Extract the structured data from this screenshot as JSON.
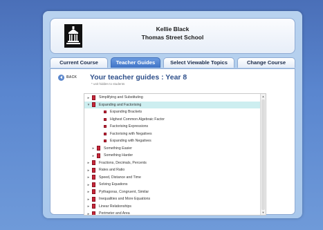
{
  "header": {
    "teacher_name": "Kellie Black",
    "school_name": "Thomas Street School",
    "logo_icon": "school-building-icon"
  },
  "tabs": [
    {
      "label": "Current Course",
      "active": false
    },
    {
      "label": "Teacher Guides",
      "active": true
    },
    {
      "label": "Select Viewable Topics",
      "active": false
    },
    {
      "label": "Change Course",
      "active": false
    }
  ],
  "content": {
    "back_label": "BACK",
    "title": "Your teacher guides : Year 8",
    "subtitle": "* unit hidden to students"
  },
  "tree": {
    "rows": [
      {
        "label": "Simplifying and Substituting",
        "level": 0,
        "arrow": "►",
        "highlight": false,
        "small": false
      },
      {
        "label": "Expanding and Factorising",
        "level": 0,
        "arrow": "▼",
        "highlight": true,
        "small": false
      },
      {
        "label": "Expanding Brackets",
        "level": 1,
        "arrow": "",
        "highlight": false,
        "small": true
      },
      {
        "label": "Highest Common Algebraic Factor",
        "level": 1,
        "arrow": "",
        "highlight": false,
        "small": true
      },
      {
        "label": "Factorising Expressions",
        "level": 1,
        "arrow": "",
        "highlight": false,
        "small": true
      },
      {
        "label": "Factorising with Negatives",
        "level": 1,
        "arrow": "",
        "highlight": false,
        "small": true
      },
      {
        "label": "Expanding with Negatives",
        "level": 1,
        "arrow": "",
        "highlight": false,
        "small": true
      },
      {
        "label": "Something Easier",
        "level": 2,
        "arrow": "►",
        "highlight": false,
        "small": false
      },
      {
        "label": "Something Harder",
        "level": 2,
        "arrow": "►",
        "highlight": false,
        "small": false
      },
      {
        "label": "Fractions, Decimals, Percents",
        "level": 0,
        "arrow": "►",
        "highlight": false,
        "small": false
      },
      {
        "label": "Rates and Ratio",
        "level": 0,
        "arrow": "►",
        "highlight": false,
        "small": false
      },
      {
        "label": "Speed, Distance and Time",
        "level": 0,
        "arrow": "►",
        "highlight": false,
        "small": false
      },
      {
        "label": "Solving Equations",
        "level": 0,
        "arrow": "►",
        "highlight": false,
        "small": false
      },
      {
        "label": "Pythagoras, Congruent, Similar",
        "level": 0,
        "arrow": "►",
        "highlight": false,
        "small": false
      },
      {
        "label": "Inequalities and More Equations",
        "level": 0,
        "arrow": "►",
        "highlight": false,
        "small": false
      },
      {
        "label": "Linear Relationships",
        "level": 0,
        "arrow": "►",
        "highlight": false,
        "small": false
      },
      {
        "label": "Perimeter and Area",
        "level": 0,
        "arrow": "►",
        "highlight": false,
        "small": false
      }
    ]
  },
  "colors": {
    "active_tab": "#3f73c6",
    "title": "#2e4f8a",
    "book": "#c8283a",
    "highlight": "#cdeef0"
  }
}
